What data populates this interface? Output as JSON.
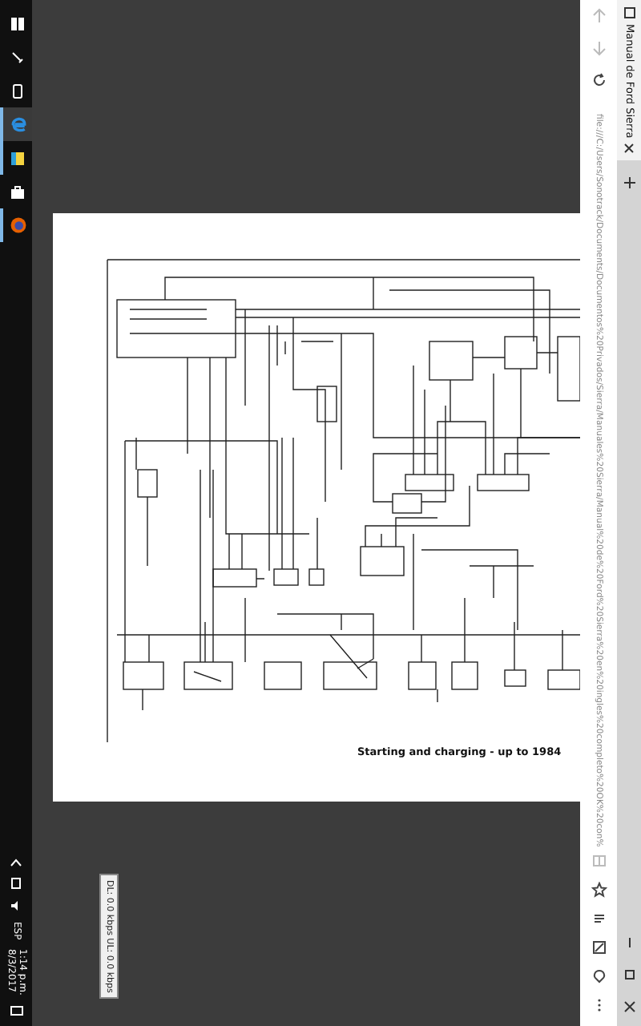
{
  "taskbar": {
    "apps": [
      {
        "kind": "task-view",
        "running": false,
        "selected": false
      },
      {
        "kind": "pen",
        "running": false,
        "selected": false
      },
      {
        "kind": "phone",
        "running": false,
        "selected": false
      },
      {
        "kind": "edge",
        "running": true,
        "selected": true
      },
      {
        "kind": "notes",
        "running": true,
        "selected": false
      },
      {
        "kind": "store",
        "running": false,
        "selected": false
      },
      {
        "kind": "firefox",
        "running": true,
        "selected": false
      }
    ],
    "language": "ESP",
    "time": "1:14 p.m.",
    "date": "8/3/2017"
  },
  "network_tooltip": "DL: 0.0 kbps UL: 0.0 kbps",
  "document": {
    "caption": "Starting and charging - up to 1984"
  },
  "browser": {
    "url": "file:///C:/Users/Sonotrack/Documents/Documentos%20Privados/Sierra/Manuales%20Sierra/Manual%20de%20Ford%20Sierra%20en%20ingles%20completo%20OK%20con%",
    "tab": {
      "title": "Manual de Ford Sierra"
    }
  }
}
